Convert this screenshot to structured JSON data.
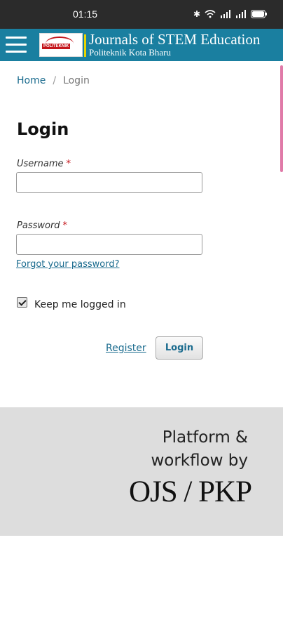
{
  "status_bar": {
    "time": "01:15"
  },
  "header": {
    "logo_text": "POLITEKNIK",
    "title": "Journals of STEM Education",
    "subtitle": "Politeknik Kota Bharu"
  },
  "breadcrumb": {
    "home": "Home",
    "separator": "/",
    "current": "Login"
  },
  "login_form": {
    "heading": "Login",
    "username_label": "Username",
    "password_label": "Password",
    "required_mark": "*",
    "username_value": "",
    "password_value": "",
    "forgot_link": "Forgot your password?",
    "remember_label": "Keep me logged in",
    "remember_checked": true,
    "register_link": "Register",
    "submit_label": "Login"
  },
  "footer": {
    "line1": "Platform &",
    "line2": "workflow by",
    "brand": "OJS / PKP"
  },
  "colors": {
    "header_bg": "#1a7fa0",
    "link": "#1a6b8e",
    "required": "#c4161c",
    "footer_bg": "#dddddd"
  }
}
